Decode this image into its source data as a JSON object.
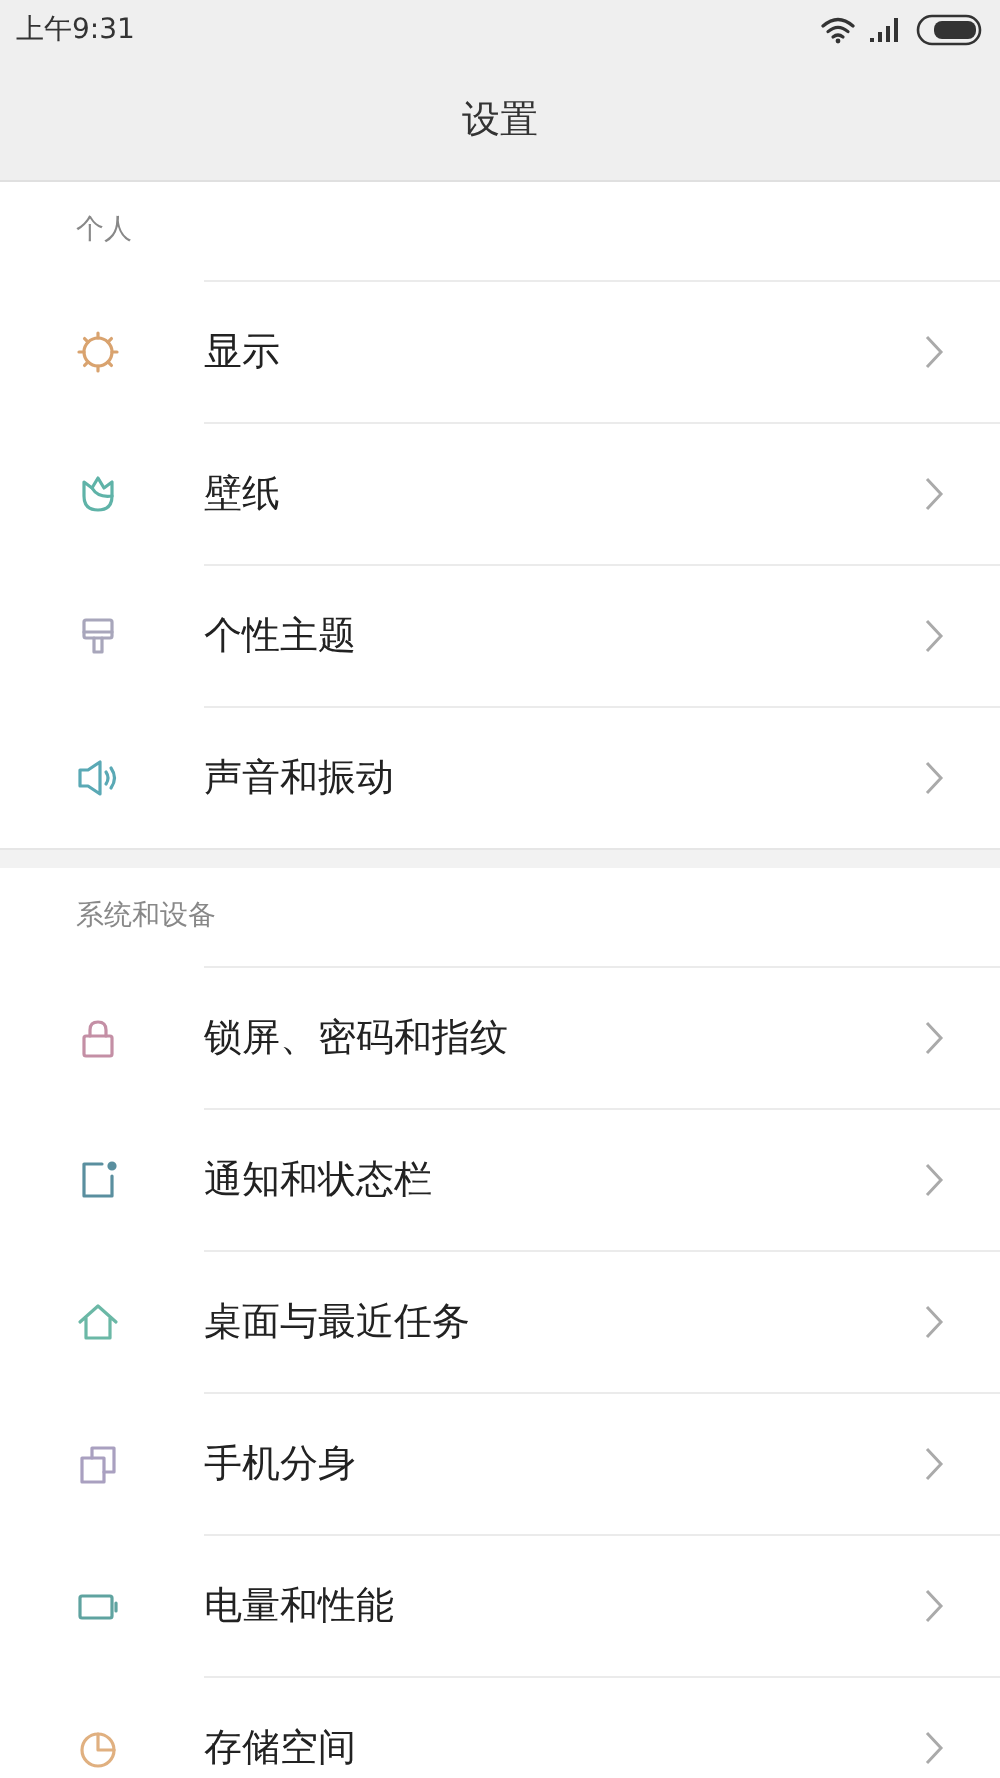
{
  "status_bar": {
    "time": "上午9:31"
  },
  "title": "设置",
  "sections": [
    {
      "header": "个人",
      "items": [
        {
          "kind": "display",
          "label": "显示",
          "color": "#d9a36f"
        },
        {
          "kind": "wallpaper",
          "label": "壁纸",
          "color": "#5fb3a8"
        },
        {
          "kind": "theme",
          "label": "个性主题",
          "color": "#a8a6bb"
        },
        {
          "kind": "sound",
          "label": "声音和振动",
          "color": "#5aa9b5"
        }
      ]
    },
    {
      "header": "系统和设备",
      "items": [
        {
          "kind": "lock",
          "label": "锁屏、密码和指纹",
          "color": "#c48fa5"
        },
        {
          "kind": "notification",
          "label": "通知和状态栏",
          "color": "#5a8f9f"
        },
        {
          "kind": "home",
          "label": "桌面与最近任务",
          "color": "#6bb8a6"
        },
        {
          "kind": "dual",
          "label": "手机分身",
          "color": "#a9a0c0"
        },
        {
          "kind": "battery",
          "label": "电量和性能",
          "color": "#5fa3a0"
        },
        {
          "kind": "storage",
          "label": "存储空间",
          "color": "#e0b080"
        }
      ]
    }
  ]
}
